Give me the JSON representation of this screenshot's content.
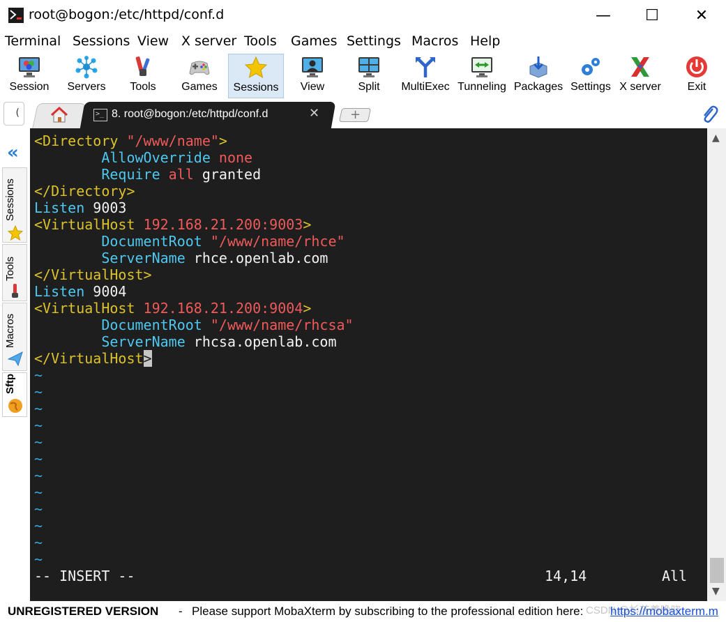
{
  "window": {
    "title": "root@bogon:/etc/httpd/conf.d",
    "minimize": "—",
    "maximize": "☐",
    "close": "✕"
  },
  "menu": [
    "Terminal",
    "Sessions",
    "View",
    "X server",
    "Tools",
    "Games",
    "Settings",
    "Macros",
    "Help"
  ],
  "toolbar": [
    {
      "label": "Session",
      "icon": "session-monitor-icon"
    },
    {
      "label": "Servers",
      "icon": "servers-network-icon"
    },
    {
      "label": "Tools",
      "icon": "tools-icon"
    },
    {
      "label": "Games",
      "icon": "gamepad-icon"
    },
    {
      "label": "Sessions",
      "icon": "star-icon",
      "active": true
    },
    {
      "label": "View",
      "icon": "view-icon"
    },
    {
      "label": "Split",
      "icon": "split-icon"
    },
    {
      "label": "MultiExec",
      "icon": "multiexec-icon"
    },
    {
      "label": "Tunneling",
      "icon": "tunneling-icon"
    },
    {
      "label": "Packages",
      "icon": "packages-icon"
    },
    {
      "label": "Settings",
      "icon": "settings-gears-icon"
    },
    {
      "label": "X server",
      "icon": "x-server-icon"
    },
    {
      "label": "Exit",
      "icon": "power-icon"
    }
  ],
  "tabs": {
    "quick_connect": "(",
    "terminal_tab_label": "8. root@bogon:/etc/httpd/conf.d",
    "terminal_tab_close": "✕",
    "new_tab": "+"
  },
  "sidebar": {
    "collapse": "«",
    "tabs": [
      "Sessions",
      "Tools",
      "Macros",
      "Sftp"
    ]
  },
  "terminal": {
    "lines": [
      [
        {
          "t": "<Directory ",
          "c": "yellow"
        },
        {
          "t": "\"/www/name\"",
          "c": "red"
        },
        {
          "t": ">",
          "c": "yellow"
        }
      ],
      [
        {
          "t": "        ",
          "c": "white"
        },
        {
          "t": "AllowOverride",
          "c": "cyan"
        },
        {
          "t": " ",
          "c": "white"
        },
        {
          "t": "none",
          "c": "red"
        }
      ],
      [
        {
          "t": "        ",
          "c": "white"
        },
        {
          "t": "Require",
          "c": "cyan"
        },
        {
          "t": " ",
          "c": "white"
        },
        {
          "t": "all",
          "c": "red"
        },
        {
          "t": " granted",
          "c": "white"
        }
      ],
      [
        {
          "t": "</Directory>",
          "c": "yellow"
        }
      ],
      [
        {
          "t": "Listen",
          "c": "cyan"
        },
        {
          "t": " 9003",
          "c": "white"
        }
      ],
      [
        {
          "t": "<VirtualHost ",
          "c": "yellow"
        },
        {
          "t": "192.168.21.200:9003",
          "c": "red"
        },
        {
          "t": ">",
          "c": "yellow"
        }
      ],
      [
        {
          "t": "        ",
          "c": "white"
        },
        {
          "t": "DocumentRoot",
          "c": "cyan"
        },
        {
          "t": " ",
          "c": "white"
        },
        {
          "t": "\"/www/name/rhce\"",
          "c": "red"
        }
      ],
      [
        {
          "t": "        ",
          "c": "white"
        },
        {
          "t": "ServerName",
          "c": "cyan"
        },
        {
          "t": " rhce.openlab.com",
          "c": "white"
        }
      ],
      [
        {
          "t": "</VirtualHost>",
          "c": "yellow"
        }
      ],
      [
        {
          "t": "Listen",
          "c": "cyan"
        },
        {
          "t": " 9004",
          "c": "white"
        }
      ],
      [
        {
          "t": "<VirtualHost ",
          "c": "yellow"
        },
        {
          "t": "192.168.21.200:9004",
          "c": "red"
        },
        {
          "t": ">",
          "c": "yellow"
        }
      ],
      [
        {
          "t": "        ",
          "c": "white"
        },
        {
          "t": "DocumentRoot",
          "c": "cyan"
        },
        {
          "t": " ",
          "c": "white"
        },
        {
          "t": "\"/www/name/rhcsa\"",
          "c": "red"
        }
      ],
      [
        {
          "t": "        ",
          "c": "white"
        },
        {
          "t": "ServerName",
          "c": "cyan"
        },
        {
          "t": " rhcsa.openlab.com",
          "c": "white"
        }
      ],
      [
        {
          "t": "</VirtualHost",
          "c": "yellow"
        },
        {
          "t": ">",
          "c": "cursor"
        }
      ],
      [
        {
          "t": "~",
          "c": "tilde"
        }
      ],
      [
        {
          "t": "~",
          "c": "tilde"
        }
      ],
      [
        {
          "t": "~",
          "c": "tilde"
        }
      ],
      [
        {
          "t": "~",
          "c": "tilde"
        }
      ],
      [
        {
          "t": "~",
          "c": "tilde"
        }
      ],
      [
        {
          "t": "~",
          "c": "tilde"
        }
      ],
      [
        {
          "t": "~",
          "c": "tilde"
        }
      ],
      [
        {
          "t": "~",
          "c": "tilde"
        }
      ],
      [
        {
          "t": "~",
          "c": "tilde"
        }
      ],
      [
        {
          "t": "~",
          "c": "tilde"
        }
      ],
      [
        {
          "t": "~",
          "c": "tilde"
        }
      ],
      [
        {
          "t": "~",
          "c": "tilde"
        }
      ]
    ],
    "status_mode": "-- INSERT --",
    "status_position": "14,14",
    "status_scroll": "All"
  },
  "bottom": {
    "unregistered": "UNREGISTERED VERSION",
    "dash": "-",
    "message": "Please support MobaXterm by subscribing to the professional edition here:",
    "link": "https://mobaxterm.m",
    "watermark": "CSDN @杉莜羡晚晓"
  },
  "colors": {
    "terminal_bg": "#1e1e1e",
    "yellow": "#dcc22c",
    "red": "#f05a5a",
    "cyan": "#4ec8f0",
    "white": "#f2f2f2",
    "tilde": "#35a7e0"
  }
}
